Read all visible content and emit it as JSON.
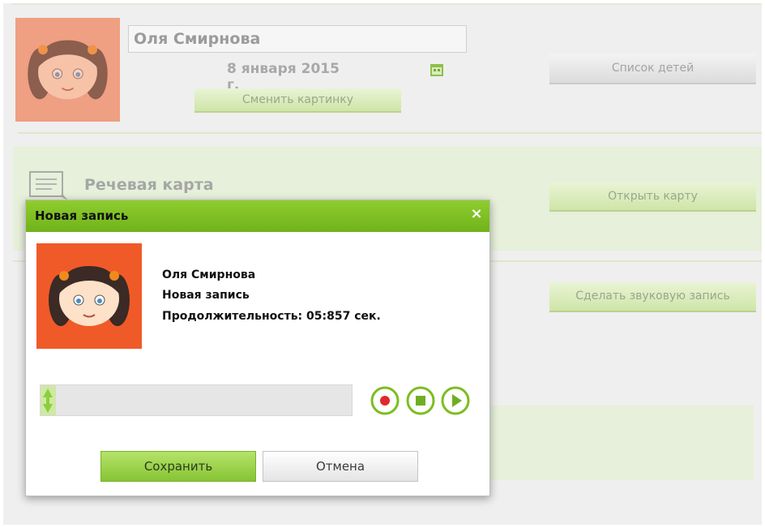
{
  "profile": {
    "name": "Оля Смирнова",
    "birth_date": "8 января 2015 г.",
    "change_picture_label": "Сменить картинку",
    "children_list_label": "Список детей"
  },
  "speech_card": {
    "title": "Речевая карта",
    "open_label": "Открыть карту"
  },
  "record_button_label": "Сделать звуковую запись",
  "dialog": {
    "title": "Новая запись",
    "close_glyph": "×",
    "child_name": "Оля Смирнова",
    "record_name": "Новая запись",
    "duration": "Продолжительность: 05:857 сек.",
    "progress": 0.05,
    "save_label": "Сохранить",
    "cancel_label": "Отмена"
  },
  "icons": {
    "calendar": "calendar-icon",
    "card": "speech-card-icon",
    "record": "record-icon",
    "stop": "stop-icon",
    "play": "play-icon",
    "seek_handle": "seek-handle-icon"
  },
  "colors": {
    "accent_green": "#7cbd22",
    "avatar_bg_faded": "#ef9f82",
    "avatar_bg": "#f05a28"
  }
}
